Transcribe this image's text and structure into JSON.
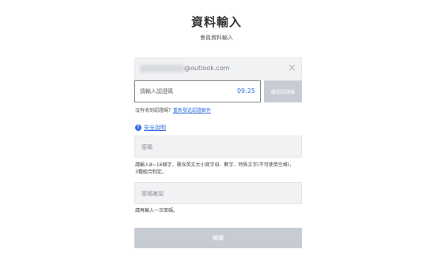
{
  "header": {
    "title": "資料輸入",
    "subtitle": "會員資料輸入"
  },
  "email": {
    "domain": "@outlook.com",
    "clear_symbol": "×"
  },
  "verification": {
    "placeholder": "請輸入認證碼",
    "timer": "09:25",
    "verify_button": "確認認證碼",
    "no_code_text": "沒有收到認證碼？",
    "resend_link": "重新發送認證郵件"
  },
  "security": {
    "icon_glyph": "!",
    "link": "安全說明"
  },
  "password": {
    "placeholder": "密碼",
    "hint_line1": "請輸入8~16個字，需含英文大小寫字母、數字、特殊文字(不可使用空格)，",
    "hint_line2": "3種組合制定。"
  },
  "password_confirm": {
    "placeholder": "密碼確認",
    "hint": "請再輸入一次密碼。"
  },
  "submit": {
    "label": "繼續"
  }
}
